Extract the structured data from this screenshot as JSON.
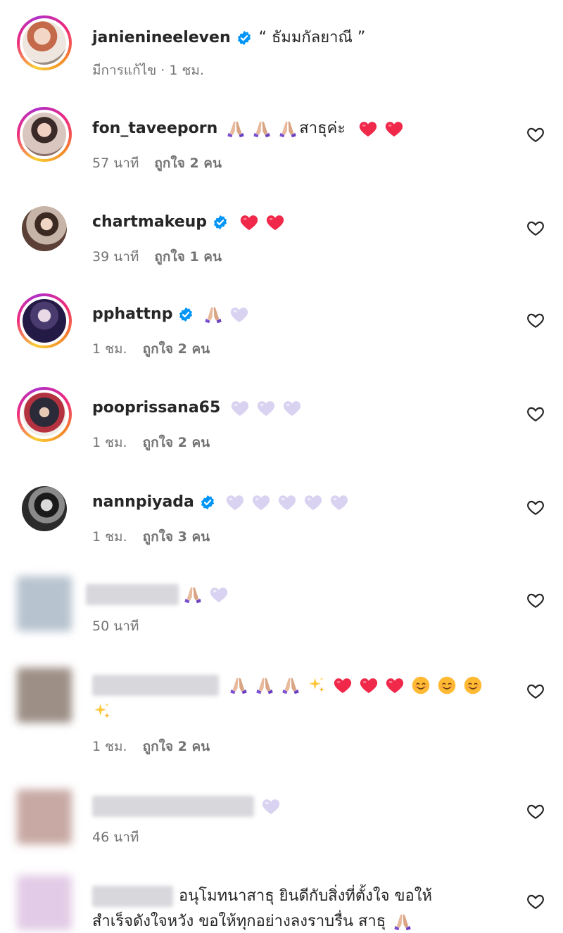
{
  "post": {
    "username": "janienineeleven",
    "caption": "“ ธัมมกัลยาณี ”",
    "meta": "มีการแก้ไข · 1 ชม."
  },
  "comments": [
    {
      "username": "fon_taveeporn",
      "text": "สาธุค่ะ",
      "time": "57 นาที",
      "likes": "ถูกใจ 2 คน"
    },
    {
      "username": "chartmakeup",
      "text": "",
      "time": "39 นาที",
      "likes": "ถูกใจ 1 คน"
    },
    {
      "username": "pphattnp",
      "text": "",
      "time": "1 ชม.",
      "likes": "ถูกใจ 2 คน"
    },
    {
      "username": "pooprissana65",
      "text": "",
      "time": "1 ชม.",
      "likes": "ถูกใจ 2 คน"
    },
    {
      "username": "nannpiyada",
      "text": "",
      "time": "1 ชม.",
      "likes": "ถูกใจ 3 คน"
    },
    {
      "username": "",
      "text": "",
      "time": "50 นาที",
      "likes": ""
    },
    {
      "username": "",
      "text": "",
      "time": "1 ชม.",
      "likes": "ถูกใจ 2 คน"
    },
    {
      "username": "",
      "text": "",
      "time": "46 นาที",
      "likes": ""
    },
    {
      "username": "",
      "text": "อนุโมทนาสาธุ ยินดีกับสิ่งที่ตั้งใจ ขอให้",
      "text2": "สำเร็จดังใจหวัง ขอให้ทุกอย่างลงราบรื่น สาธุ",
      "time": "",
      "likes": ""
    }
  ],
  "icons": {
    "heart_outline": "heart-outline-icon",
    "verified": "verified-badge-icon",
    "emoji_pray": "folded-hands-emoji",
    "emoji_red_heart": "red-heart-emoji",
    "emoji_lavender_heart": "light-purple-heart-emoji",
    "emoji_sparkles": "sparkles-emoji",
    "emoji_smile": "smiling-face-emoji"
  },
  "colors": {
    "verified": "#0095f6",
    "meta": "#737373",
    "text": "#262626"
  }
}
